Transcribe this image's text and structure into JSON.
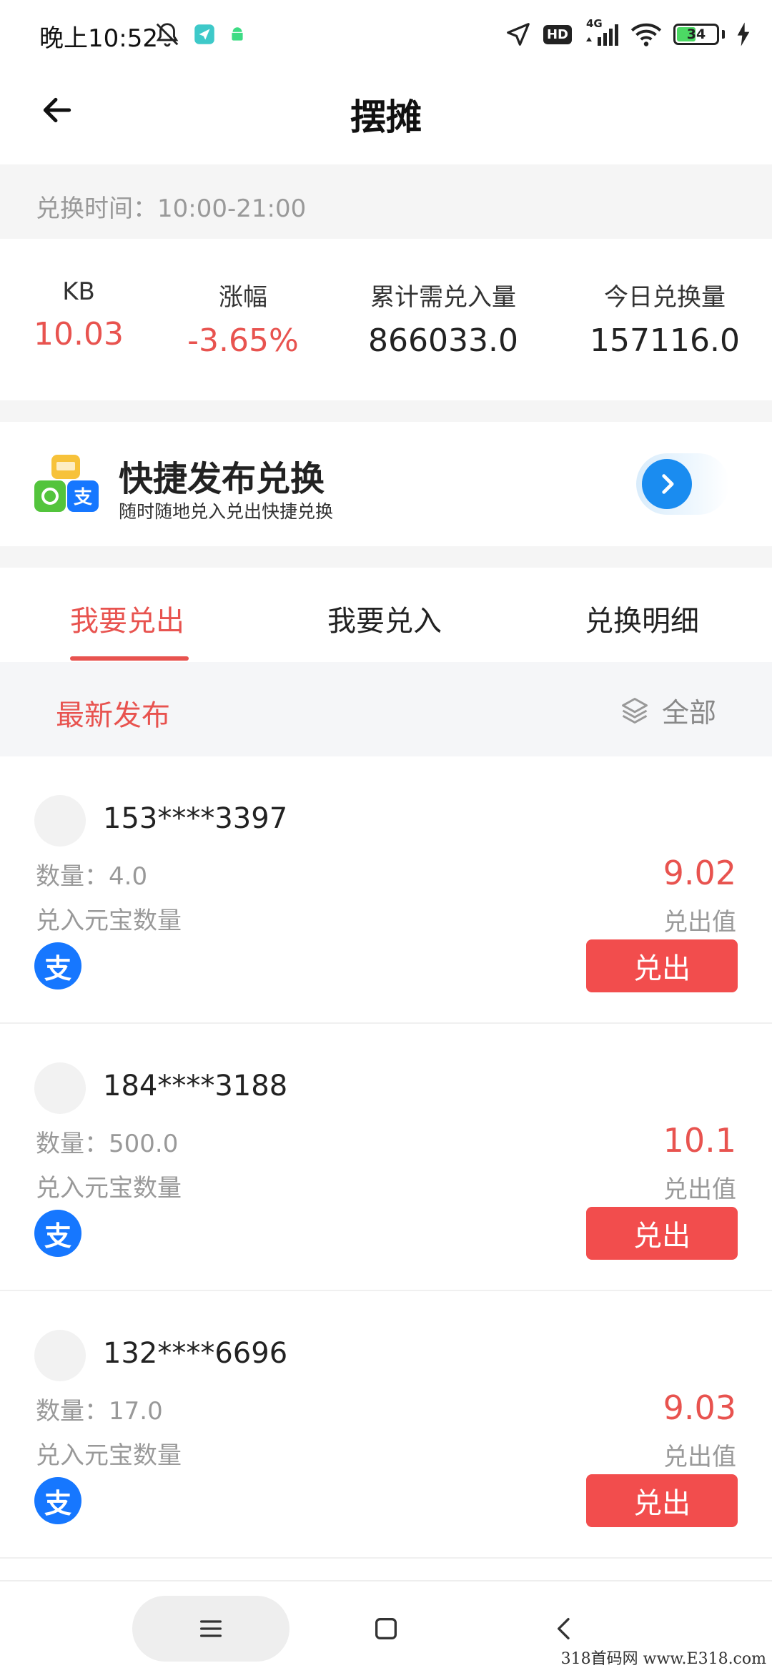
{
  "status_bar": {
    "time": "晚上10:52",
    "network": "HD",
    "signal_tag": "4G",
    "battery": "34"
  },
  "header": {
    "title": "摆摊"
  },
  "exchange_time": "兑换时间：10:00-21:00",
  "stats": [
    {
      "label": "KB",
      "value": "10.03"
    },
    {
      "label": "涨幅",
      "value": "-3.65%"
    },
    {
      "label": "累计需兑入量",
      "value": "866033.0"
    },
    {
      "label": "今日兑换量",
      "value": "157116.0"
    }
  ],
  "banner": {
    "title": "快捷发布兑换",
    "subtitle": "随时随地兑入兑出快捷兑换"
  },
  "tabs": [
    {
      "label": "我要兑出",
      "active": true
    },
    {
      "label": "我要兑入",
      "active": false
    },
    {
      "label": "兑换明细",
      "active": false
    }
  ],
  "filter": {
    "left": "最新发布",
    "right": "全部"
  },
  "listings": [
    {
      "phone": "153****3397",
      "quantity": "数量：4.0",
      "quantity_desc": "兑入元宝数量",
      "pay_glyph": "支",
      "price": "9.02",
      "price_label": "兑出值",
      "button": "兑出"
    },
    {
      "phone": "184****3188",
      "quantity": "数量：500.0",
      "quantity_desc": "兑入元宝数量",
      "pay_glyph": "支",
      "price": "10.1",
      "price_label": "兑出值",
      "button": "兑出"
    },
    {
      "phone": "132****6696",
      "quantity": "数量：17.0",
      "quantity_desc": "兑入元宝数量",
      "pay_glyph": "支",
      "price": "9.03",
      "price_label": "兑出值",
      "button": "兑出"
    }
  ],
  "watermark": "318首码网 www.E318.com",
  "colors": {
    "accent": "#e8534f",
    "button": "#f24d4d",
    "alipay": "#1677ff"
  }
}
